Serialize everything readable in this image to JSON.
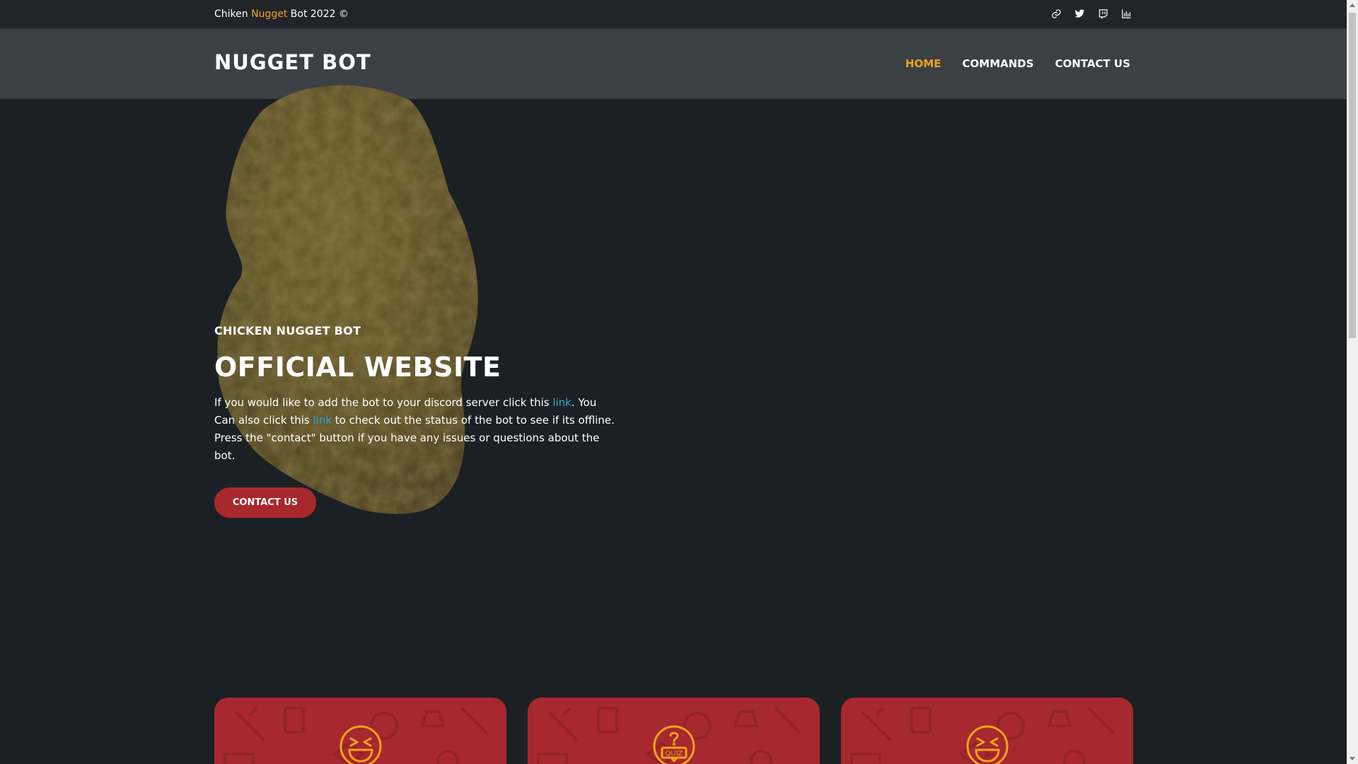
{
  "topbar": {
    "copyright_prefix": "Chiken ",
    "copyright_accent": "Nugget",
    "copyright_suffix": " Bot 2022 ©",
    "social_icons": [
      "link-icon",
      "twitter-icon",
      "twitch-icon",
      "stats-icon"
    ]
  },
  "header": {
    "brand": "NUGGET BOT",
    "nav": [
      {
        "label": "HOME",
        "active": true
      },
      {
        "label": "COMMANDS",
        "active": false
      },
      {
        "label": "CONTACT US",
        "active": false
      }
    ]
  },
  "hero": {
    "eyebrow": "CHICKEN NUGGET BOT",
    "headline": "OFFICIAL WEBSITE",
    "desc_part1": "If you would like to add the bot to your discord server click this ",
    "link1": "link",
    "desc_part2": ". You Can also click this ",
    "link2": "link",
    "desc_part3": " to check out the status of the bot to see if its offline. Press the \"contact\" button if you have any issues or questions about the bot.",
    "cta_label": "CONTACT US"
  },
  "cards": [
    {
      "icon": "laughing-face-icon"
    },
    {
      "icon": "quiz-icon"
    },
    {
      "icon": "laughing-face-icon"
    }
  ],
  "colors": {
    "accent": "#f2a31b",
    "link": "#2aa8d6",
    "button": "#a9282e",
    "card": "#a7282f",
    "background": "#1b2024",
    "header": "#3b4044"
  }
}
